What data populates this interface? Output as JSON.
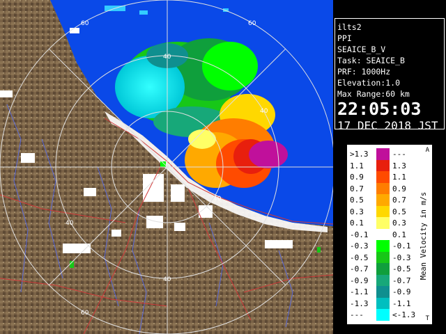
{
  "info": {
    "site": "ilts2",
    "scan_type": "PPI",
    "product": "SEAICE_B_V",
    "task": "Task: SEAICE_B",
    "prf": "PRF: 1000Hz",
    "elevation": "Elevation:1.0",
    "max_range": "Max Range:60 km",
    "time": "22:05:03",
    "date": "17 DEC 2018 JST"
  },
  "legend": {
    "unit_label": "Mean Velocity in m/s",
    "top_marker": "A",
    "bottom_marker": "T",
    "rows": [
      {
        "left": ">1.3",
        "right": "---",
        "color": "#c0109b"
      },
      {
        "left": "1.1",
        "right": "1.3",
        "color": "#e81f0d"
      },
      {
        "left": "0.9",
        "right": "1.1",
        "color": "#ff4b00"
      },
      {
        "left": "0.7",
        "right": "0.9",
        "color": "#ff7d00"
      },
      {
        "left": "0.5",
        "right": "0.7",
        "color": "#ffa900"
      },
      {
        "left": "0.3",
        "right": "0.5",
        "color": "#ffd800"
      },
      {
        "left": "0.1",
        "right": "0.3",
        "color": "#ffff66"
      },
      {
        "left": "-0.1",
        "right": "0.1",
        "color": "#ffffff"
      },
      {
        "left": "-0.3",
        "right": "-0.1",
        "color": "#00ff00"
      },
      {
        "left": "-0.5",
        "right": "-0.3",
        "color": "#17c717"
      },
      {
        "left": "-0.7",
        "right": "-0.5",
        "color": "#0f9f3c"
      },
      {
        "left": "-0.9",
        "right": "-0.7",
        "color": "#17a879"
      },
      {
        "left": "-1.1",
        "right": "-0.9",
        "color": "#0f8f8f"
      },
      {
        "left": "-1.3",
        "right": "-1.1",
        "color": "#00bfbf"
      },
      {
        "left": "---",
        "right": "<-1.3",
        "color": "#00ffff"
      }
    ]
  },
  "range_labels": {
    "r60_top_left": "60",
    "r60_top_right": "60",
    "r40_top": "40",
    "r40_right": "40",
    "r40_right_low": "40",
    "r40_left": "40",
    "r40_bottom": "40",
    "r60_bottom": "60"
  },
  "colors": {
    "sea": "#0a49e8",
    "land": "#7a6246",
    "snow": "#ffffff",
    "range_ring": "#e0e0e0",
    "road": "#d03a3a",
    "river": "#5a6ad8"
  }
}
